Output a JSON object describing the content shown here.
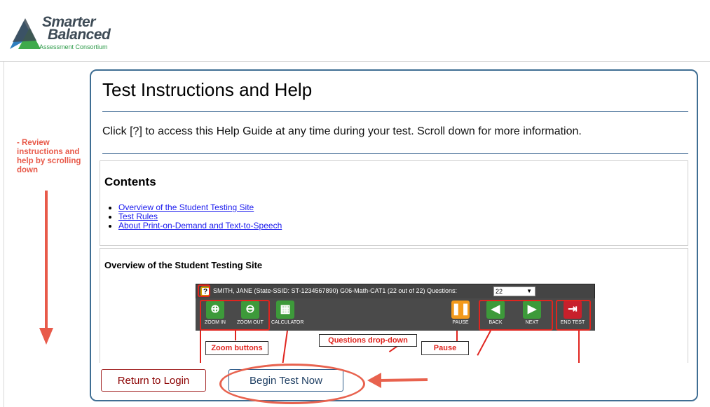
{
  "logo": {
    "line1": "Smarter",
    "line2": "Balanced",
    "line3": "Assessment Consortium"
  },
  "annotation": {
    "text": "- Review instructions and help by scrolling down"
  },
  "help": {
    "title": "Test Instructions and Help",
    "intro": "Click [?] to access this Help Guide at any time during your test. Scroll down for more information.",
    "contents_heading": "Contents",
    "contents_links": [
      "Overview of the Student Testing Site",
      "Test Rules",
      "About Print-on-Demand and Text-to-Speech"
    ],
    "overview_heading": "Overview of the Student Testing Site"
  },
  "screenshot": {
    "help_glyph": "?",
    "status": "SMITH, JANE (State-SSID: ST-1234567890)  G06-Math-CAT1 (22 out of 22)  Questions:",
    "question_select": "22",
    "tools": {
      "zoom_in": "ZOOM IN",
      "zoom_out": "ZOOM OUT",
      "calculator": "CALCULATOR",
      "pause": "PAUSE",
      "back": "BACK",
      "next": "NEXT",
      "end_test": "END TEST"
    },
    "callouts": {
      "zoom": "Zoom buttons",
      "questions": "Questions drop-down",
      "pause": "Pause"
    }
  },
  "footer": {
    "return_label": "Return to Login",
    "begin_label": "Begin Test Now"
  },
  "colors": {
    "panel_border": "#3f6e93",
    "annotation_red": "#e85a4a",
    "link_blue": "#1a1aee",
    "return_text": "#8b0000"
  },
  "icons": [
    "help-icon",
    "zoom-in-icon",
    "zoom-out-icon",
    "calculator-icon",
    "pause-icon",
    "back-arrow-icon",
    "next-arrow-icon",
    "end-test-icon"
  ]
}
